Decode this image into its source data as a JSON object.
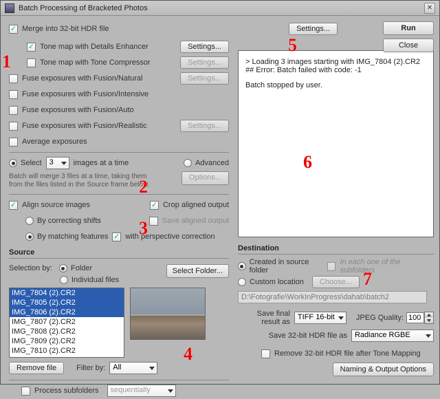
{
  "title": "Batch Processing of Bracketed Photos",
  "buttons": {
    "run": "Run",
    "close": "Close",
    "settings": "Settings...",
    "options": "Options...",
    "selectFolder": "Select Folder...",
    "removeFile": "Remove file",
    "choose": "Choose...",
    "namingOutput": "Naming & Output Options"
  },
  "opts": {
    "mergeHDR": "Merge into 32-bit HDR file",
    "detailsEnhancer": "Tone map with Details Enhancer",
    "toneCompressor": "Tone map with Tone Compressor",
    "fusionNatural": "Fuse exposures with Fusion/Natural",
    "fusionIntensive": "Fuse exposures with Fusion/Intensive",
    "fusionAuto": "Fuse exposures with Fusion/Auto",
    "fusionRealistic": "Fuse exposures with Fusion/Realistic",
    "avgExposures": "Average exposures"
  },
  "selrow": {
    "select": "Select",
    "selectVal": "3",
    "imagesAtATime": "images at a time",
    "advanced": "Advanced",
    "hint": "Batch will merge 3 files at a time, taking them from the files listed in the Source frame below."
  },
  "align": {
    "alignSource": "Align source images",
    "byShifts": "By correcting shifts",
    "byFeatures": "By matching features",
    "perspective": "with perspective correction",
    "crop": "Crop aligned output",
    "save": "Save aligned output"
  },
  "source": {
    "header": "Source",
    "selectionBy": "Selection by:",
    "folder": "Folder",
    "individual": "Individual files",
    "files": [
      "IMG_7804 (2).CR2",
      "IMG_7805 (2).CR2",
      "IMG_7806 (2).CR2",
      "IMG_7807 (2).CR2",
      "IMG_7808 (2).CR2",
      "IMG_7809 (2).CR2",
      "IMG_7810 (2).CR2"
    ],
    "filterBy": "Filter by:",
    "filterVal": "All",
    "processSubfolders": "Process subfolders",
    "subfolderMode": "sequentially"
  },
  "log": {
    "line1": "> Loading 3 images starting with IMG_7804 (2).CR2",
    "line2": "## Error: Batch failed with code:  -1",
    "line3": "Batch stopped by user."
  },
  "dest": {
    "header": "Destination",
    "createdInSource": "Created in source folder",
    "eachSubfolder": "In each one of the subfolders",
    "customLocation": "Custom location",
    "path": "D:\\Fotografie\\WorkInProgress\\dahab\\batch2",
    "saveFinalAs": "Save final result as",
    "tiff": "TIFF 16-bit",
    "jpegQuality": "JPEG Quality:",
    "jpegVal": "100",
    "save32As": "Save 32-bit HDR file as",
    "radiance": "Radiance RGBE",
    "remove32": "Remove 32-bit HDR file after Tone Mapping"
  },
  "ann": {
    "n1": "1",
    "n2": "2",
    "n3": "3",
    "n4": "4",
    "n5": "5",
    "n6": "6",
    "n7": "7"
  }
}
